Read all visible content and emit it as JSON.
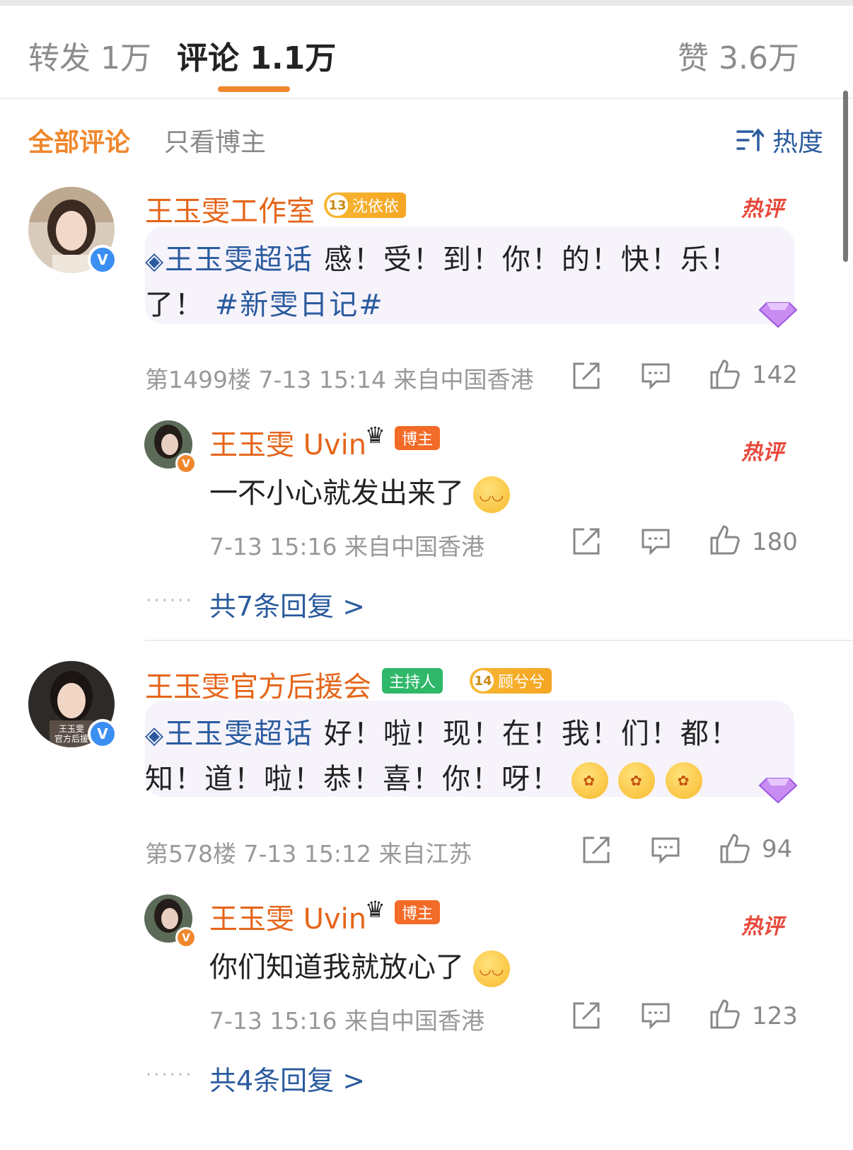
{
  "tabs": [
    {
      "label": "转发 1万",
      "active": false
    },
    {
      "label": "评论 1.1万",
      "active": true
    },
    {
      "label": "赞 3.6万",
      "active": false
    }
  ],
  "filters": {
    "all": "全部评论",
    "blogger_only": "只看博主",
    "sort": "热度"
  },
  "colors": {
    "accent": "#f0872c",
    "username": "#e5651a",
    "link": "#2b5b9e",
    "hot": "#e8483b"
  },
  "comments": [
    {
      "username": "王玉雯工作室",
      "badge": {
        "level": "13",
        "name": "沈依依"
      },
      "hot": "热评",
      "topic": "王玉雯超话",
      "line1": "感！受！到！你！的！快！乐！",
      "line2_prefix": "了！",
      "hashtag": "#新雯日记#",
      "meta": "第1499楼 7-13 15:14 来自中国香港",
      "likes": "142",
      "reply": {
        "username": "王玉雯 Uvin",
        "badge": "博主",
        "hot": "热评",
        "text": "一不小心就发出来了",
        "meta": "7-13 15:16 来自中国香港",
        "likes": "180"
      },
      "more": "共7条回复 >"
    },
    {
      "username": "王玉雯官方后援会",
      "badge_role": "主持人",
      "badge": {
        "level": "14",
        "name": "顾兮兮"
      },
      "avatar_text": "王玉雯\n官方后援",
      "topic": "王玉雯超话",
      "line1": "好！啦！现！在！我！们！都！",
      "line2": "知！道！啦！恭！喜！你！呀！",
      "meta": "第578楼 7-13 15:12 来自江苏",
      "likes": "94",
      "reply": {
        "username": "王玉雯 Uvin",
        "badge": "博主",
        "hot": "热评",
        "text": "你们知道我就放心了",
        "meta": "7-13 15:16 来自中国香港",
        "likes": "123"
      },
      "more": "共4条回复 >"
    }
  ],
  "icons": [
    "verified-icon",
    "share-icon",
    "comment-icon",
    "like-icon",
    "sort-icon",
    "crown-icon",
    "diamond-icon",
    "emoji-icon"
  ]
}
